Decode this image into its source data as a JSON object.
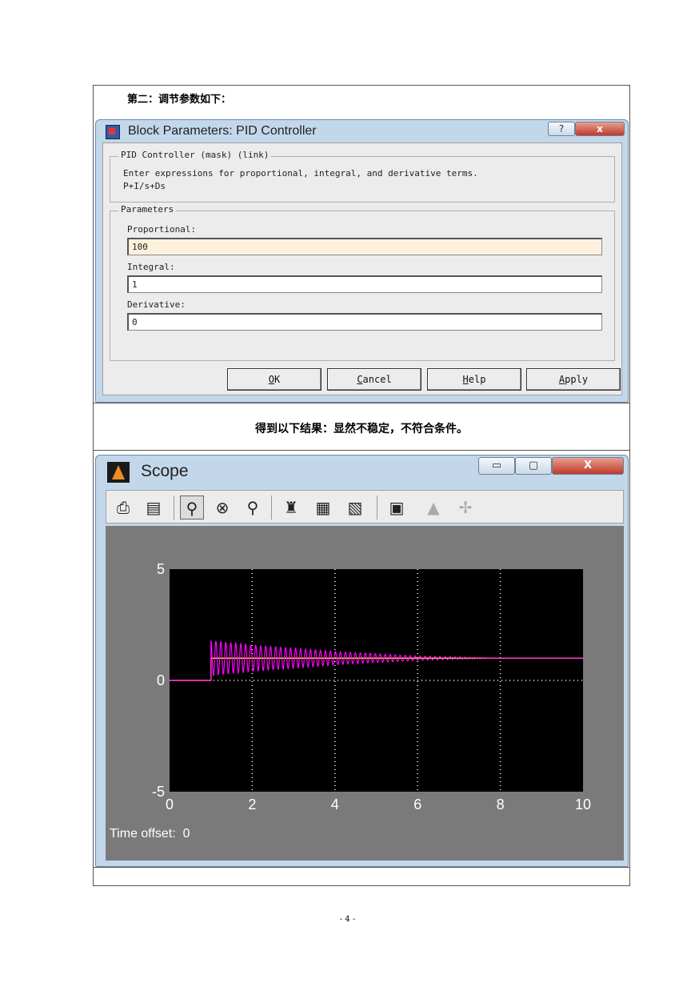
{
  "document": {
    "heading_params": "第二：调节参数如下：",
    "heading_result": "得到以下结果：显然不稳定，不符合条件。",
    "page_number": "- 4 -"
  },
  "dialog": {
    "title": "Block Parameters: PID Controller",
    "title_help_glyph": "?",
    "title_close_glyph": "x",
    "mask_group_label": "PID Controller (mask) (link)",
    "description_line1": "Enter expressions for proportional, integral, and derivative terms.",
    "description_line2": "P+I/s+Ds",
    "params_group_label": "Parameters",
    "fields": [
      {
        "label": "Proportional:",
        "value": "100"
      },
      {
        "label": "Integral:",
        "value": "1"
      },
      {
        "label": "Derivative:",
        "value": "0"
      }
    ],
    "buttons": {
      "ok": {
        "mnemonic": "O",
        "rest": "K"
      },
      "cancel": {
        "mnemonic": "C",
        "rest": "ancel"
      },
      "help": {
        "mnemonic": "H",
        "rest": "elp"
      },
      "apply": {
        "mnemonic": "A",
        "rest": "pply"
      }
    }
  },
  "scope": {
    "title": "Scope",
    "window_buttons": {
      "minimize": "▭",
      "maximize": "▢",
      "close": "X"
    },
    "toolbar_icons": [
      "print-icon",
      "parameters-icon",
      "zoom-icon",
      "zoom-x-icon",
      "zoom-y-icon",
      "autoscale-icon",
      "save-axes-icon",
      "restore-axes-icon",
      "floating-scope-icon",
      "lock-axes-icon",
      "signal-selection-icon"
    ],
    "time_offset_label": "Time offset:",
    "time_offset_value": "0",
    "colors": {
      "background": "#000000",
      "grid": "#ffffff",
      "response": "#ff00ff",
      "reference": "#ffff00",
      "plot_frame": "#7a7a7a"
    }
  },
  "chart_data": {
    "type": "line",
    "title": "",
    "xlabel": "",
    "ylabel": "",
    "xlim": [
      0,
      10
    ],
    "ylim": [
      -5,
      5
    ],
    "x_ticks": [
      "0",
      "2",
      "4",
      "6",
      "8",
      "10"
    ],
    "y_ticks": [
      "5",
      "0",
      "-5"
    ],
    "grid": true,
    "series": [
      {
        "color": "#ffff00",
        "x": [
          0,
          1,
          1,
          10
        ],
        "y": [
          0,
          0,
          1,
          1
        ]
      },
      {
        "color": "#ff00ff",
        "x": [
          0,
          1,
          1.05,
          1.1,
          1.2,
          2,
          3,
          4,
          5,
          6,
          7,
          8,
          10
        ],
        "y": [
          0,
          0,
          1.8,
          0.2,
          1.8,
          1.6,
          1.45,
          1.3,
          1.2,
          1.1,
          1.05,
          1.0,
          1.0
        ]
      }
    ]
  }
}
